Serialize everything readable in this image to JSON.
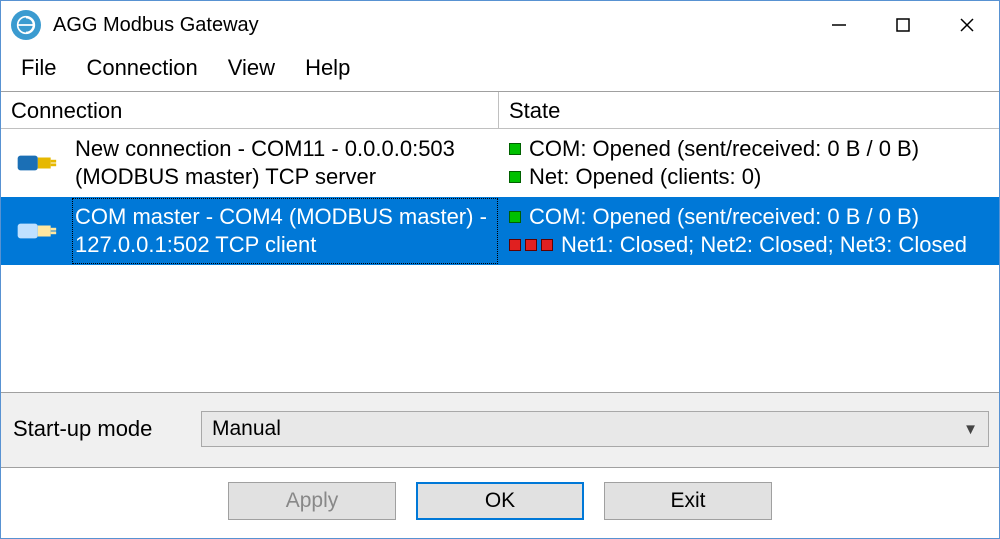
{
  "title": "AGG Modbus Gateway",
  "menubar": {
    "file": "File",
    "connection": "Connection",
    "view": "View",
    "help": "Help"
  },
  "columns": {
    "connection": "Connection",
    "state": "State"
  },
  "rows": [
    {
      "selected": false,
      "conn_l1": "New connection - COM11 - 0.0.0.0:503",
      "conn_l2": "(MODBUS master) TCP server",
      "state": [
        {
          "indicators": [
            "green"
          ],
          "text": "COM: Opened (sent/received: 0 B / 0 B)"
        },
        {
          "indicators": [
            "green"
          ],
          "text": "Net: Opened (clients: 0)"
        }
      ]
    },
    {
      "selected": true,
      "conn_l1": "COM master - COM4 (MODBUS master) -",
      "conn_l2": "127.0.0.1:502 TCP client",
      "state": [
        {
          "indicators": [
            "green"
          ],
          "text": "COM: Opened (sent/received: 0 B / 0 B)"
        },
        {
          "indicators": [
            "red",
            "red",
            "red"
          ],
          "text": "Net1: Closed; Net2: Closed; Net3: Closed"
        }
      ]
    }
  ],
  "startup": {
    "label": "Start-up mode",
    "value": "Manual"
  },
  "buttons": {
    "apply": "Apply",
    "ok": "OK",
    "exit": "Exit"
  }
}
